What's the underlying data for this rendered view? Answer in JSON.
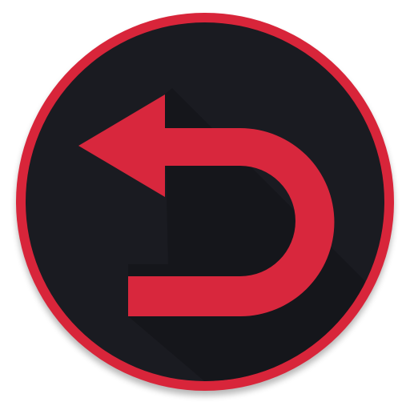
{
  "icon": {
    "name": "undo-arrow-icon",
    "colors": {
      "ring": "#d8253a",
      "face": "#1a1b21",
      "arrow": "#d8273d",
      "long_shadow": "#121317",
      "drop_shadow": "#000000",
      "background": "#ffffff"
    }
  }
}
